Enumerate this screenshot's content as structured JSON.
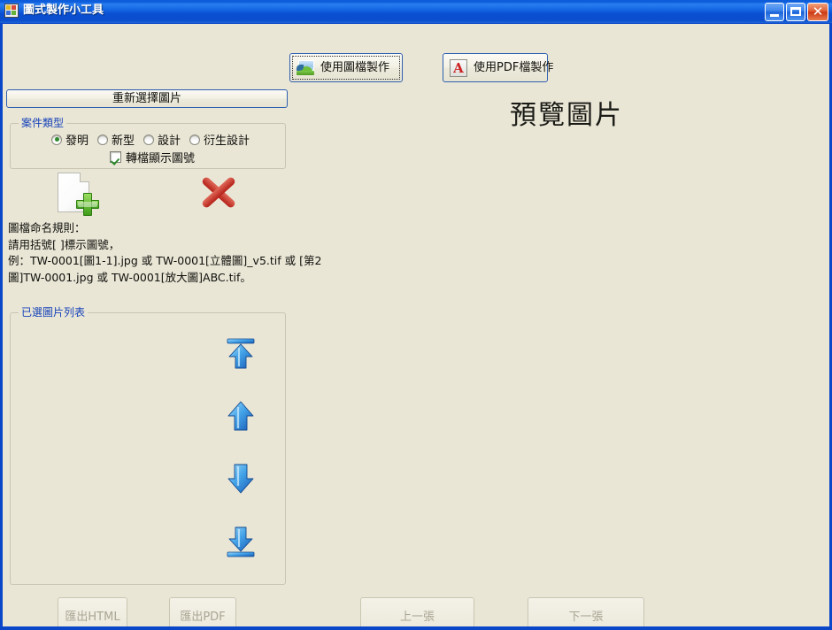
{
  "window": {
    "title": "圖式製作小工具",
    "icon": "app-icon",
    "controls": {
      "minimize": "_",
      "maximize": "□",
      "close": "✕"
    }
  },
  "toolbar": {
    "image_make_label": "使用圖檔製作",
    "image_make_icon": "picture-icon",
    "pdf_make_label": "使用PDF檔製作",
    "pdf_make_icon": "pdf-icon"
  },
  "reselect": {
    "label": "重新選擇圖片"
  },
  "case_type": {
    "title": "案件類型",
    "options": [
      {
        "label": "發明",
        "checked": true
      },
      {
        "label": "新型",
        "checked": false
      },
      {
        "label": "設計",
        "checked": false
      },
      {
        "label": "衍生設計",
        "checked": false
      }
    ],
    "checkbox": {
      "label": "轉檔顯示圖號",
      "checked": true
    }
  },
  "file_actions": {
    "add_icon": "add-file-icon",
    "delete_icon": "delete-red-x-icon"
  },
  "naming_rules": {
    "line1": "圖檔命名規則：",
    "line2": "請用括號[ ]標示圖號，",
    "line3": "例：TW-0001[圖1-1].jpg 或 TW-0001[立體圖]_v5.tif 或 [第2",
    "line4": "圖]TW-0001.jpg 或 TW-0001[放大圖]ABC.tif。"
  },
  "selected_list": {
    "title": "已選圖片列表",
    "items": [],
    "arrows": [
      {
        "name": "move-to-top",
        "icon": "arrow-to-top-icon"
      },
      {
        "name": "move-up",
        "icon": "arrow-up-icon"
      },
      {
        "name": "move-down",
        "icon": "arrow-down-icon"
      },
      {
        "name": "move-to-bottom",
        "icon": "arrow-to-bottom-icon"
      }
    ]
  },
  "preview": {
    "title": "預覽圖片"
  },
  "bottom_buttons": {
    "export_html": {
      "label": "匯出HTML",
      "enabled": false
    },
    "export_pdf": {
      "label": "匯出PDF",
      "enabled": false
    },
    "prev": {
      "label": "上一張",
      "enabled": false
    },
    "next": {
      "label": "下一張",
      "enabled": false
    }
  },
  "colors": {
    "client_background": "#e9e6d6",
    "window_border": "#0a46c8",
    "titlebar_blue": "#1568e4",
    "groupbox_title": "#1743b8",
    "accent_button_border": "#2f5fb0"
  }
}
